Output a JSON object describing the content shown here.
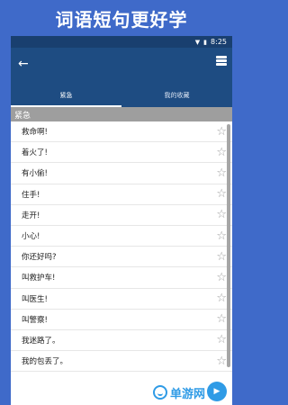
{
  "banner": {
    "title": "词语短句更好学"
  },
  "status_bar": {
    "time": "8:25",
    "icons": [
      "wifi-icon",
      "battery-icon"
    ]
  },
  "app_bar": {
    "back_icon": "back-arrow-icon",
    "action_icon": "flashcards-icon"
  },
  "tabs": [
    {
      "label": "紧急",
      "active": true
    },
    {
      "label": "我的收藏",
      "active": false
    }
  ],
  "section": {
    "title": "紧急"
  },
  "phrases": [
    "救命啊!",
    "着火了!",
    "有小偷!",
    "住手!",
    "走开!",
    "小心!",
    "你还好吗?",
    "叫救护车!",
    "叫医生!",
    "叫警察!",
    "我迷路了。",
    "我的包丢了。"
  ],
  "fab": {
    "icon": "play-icon"
  },
  "watermark": {
    "text": "单游网"
  },
  "colors": {
    "background": "#3f6ac9",
    "app_bar": "#1e4c82",
    "status_bar": "#193f6f",
    "section": "#9e9e9e",
    "accent": "#2f9be6"
  }
}
